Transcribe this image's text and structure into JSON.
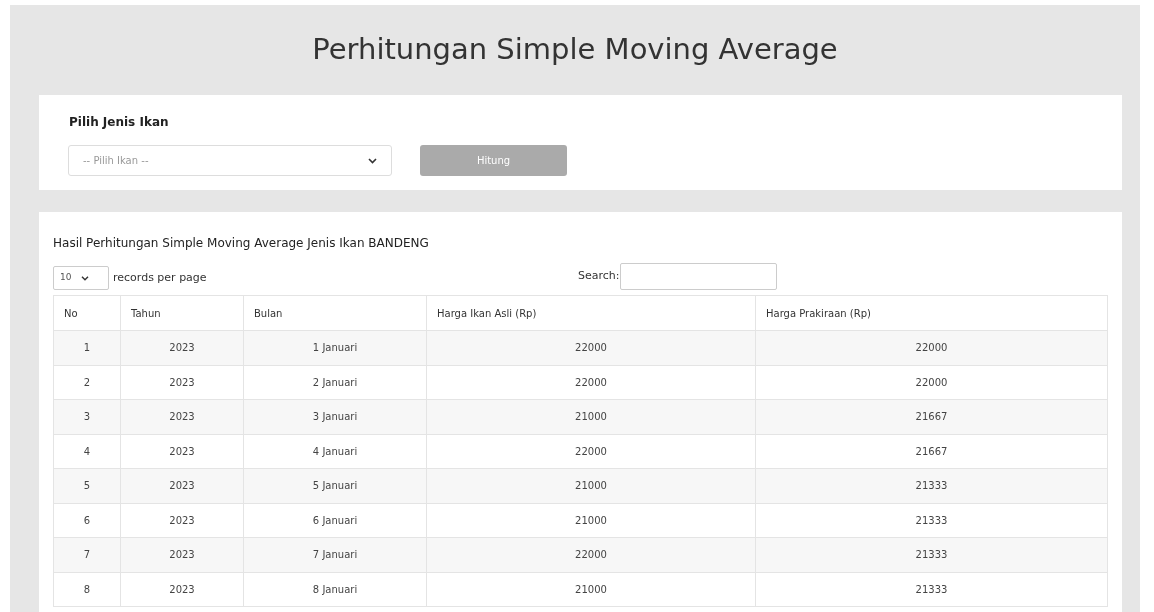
{
  "title": "Perhitungan Simple Moving Average",
  "form": {
    "label": "Pilih Jenis Ikan",
    "select_placeholder": "-- Pilih Ikan --",
    "button": "Hitung",
    "button_disabled": true
  },
  "result": {
    "heading": "Hasil Perhitungan Simple Moving Average Jenis Ikan BANDENG",
    "page_length": "10",
    "page_length_suffix": "records per page",
    "search_label": "Search:",
    "table": {
      "columns": [
        "No",
        "Tahun",
        "Bulan",
        "Harga Ikan Asli (Rp)",
        "Harga Prakiraan (Rp)"
      ],
      "rows": [
        [
          "1",
          "2023",
          "1 Januari",
          "22000",
          "22000"
        ],
        [
          "2",
          "2023",
          "2 Januari",
          "22000",
          "22000"
        ],
        [
          "3",
          "2023",
          "3 Januari",
          "21000",
          "21667"
        ],
        [
          "4",
          "2023",
          "4 Januari",
          "22000",
          "21667"
        ],
        [
          "5",
          "2023",
          "5 Januari",
          "21000",
          "21333"
        ],
        [
          "6",
          "2023",
          "6 Januari",
          "21000",
          "21333"
        ],
        [
          "7",
          "2023",
          "7 Januari",
          "22000",
          "21333"
        ],
        [
          "8",
          "2023",
          "8 Januari",
          "21000",
          "21333"
        ]
      ]
    }
  }
}
